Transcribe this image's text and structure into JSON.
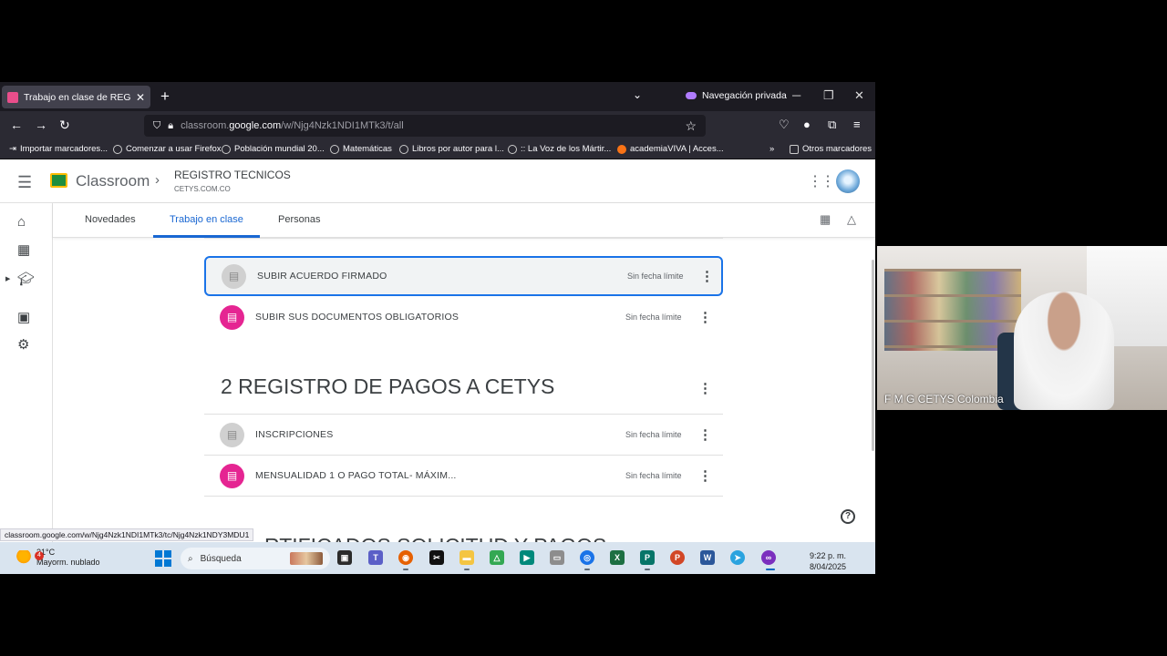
{
  "browser": {
    "tab_title": "Trabajo en clase de REGISTRO T",
    "tab_close": "✕",
    "new_tab": "+",
    "private_label": "Navegación privada",
    "url_prefix": "classroom.",
    "url_domain": "google.com",
    "url_path": "/w/Njg4Nzk1NDI1MTk3/t/all",
    "bookmarks": [
      "Importar marcadores...",
      "Comenzar a usar Firefox",
      "Población mundial 20...",
      "Matemáticas",
      "Libros por autor para l...",
      ":: La Voz de los Mártir...",
      "academiaVIVA | Acces..."
    ],
    "other_bookmarks": "Otros marcadores",
    "status_url": "classroom.google.com/w/Njg4Nzk1NDI1MTk3/tc/Njg4Nzk1NDY3MDU1"
  },
  "header": {
    "app_name": "Classroom",
    "course_title": "REGISTRO TECNICOS",
    "course_subtitle": "CETYS.COM.CO"
  },
  "tabs": [
    "Novedades",
    "Trabajo en clase",
    "Personas"
  ],
  "items": [
    {
      "title": "SUBIR ACUERDO FIRMADO",
      "due": "Sin fecha límite"
    },
    {
      "title": "SUBIR SUS DOCUMENTOS OBLIGATORIOS",
      "due": "Sin fecha límite"
    }
  ],
  "topic": {
    "title": "2 REGISTRO DE PAGOS A CETYS",
    "items": [
      {
        "title": "INSCRIPCIONES",
        "due": "Sin fecha límite"
      },
      {
        "title": "MENSUALIDAD 1 O PAGO TOTAL- MÁXIM...",
        "due": "Sin fecha límite"
      }
    ]
  },
  "next_topic_partial": "RTIFICADOS SOLICITUD Y PAGOS",
  "taskbar": {
    "weather_temp": "21°C",
    "weather_desc": "Mayorm. nublado",
    "weather_badge": "4",
    "search_placeholder": "Búsqueda",
    "time": "9:22 p. m.",
    "date": "8/04/2025"
  },
  "webcam": {
    "caption": "F M G CETYS Colombia"
  },
  "colors": {
    "accent": "#1967d2",
    "assignment_pink": "#e52592",
    "classroom_green": "#1e8e3e"
  }
}
